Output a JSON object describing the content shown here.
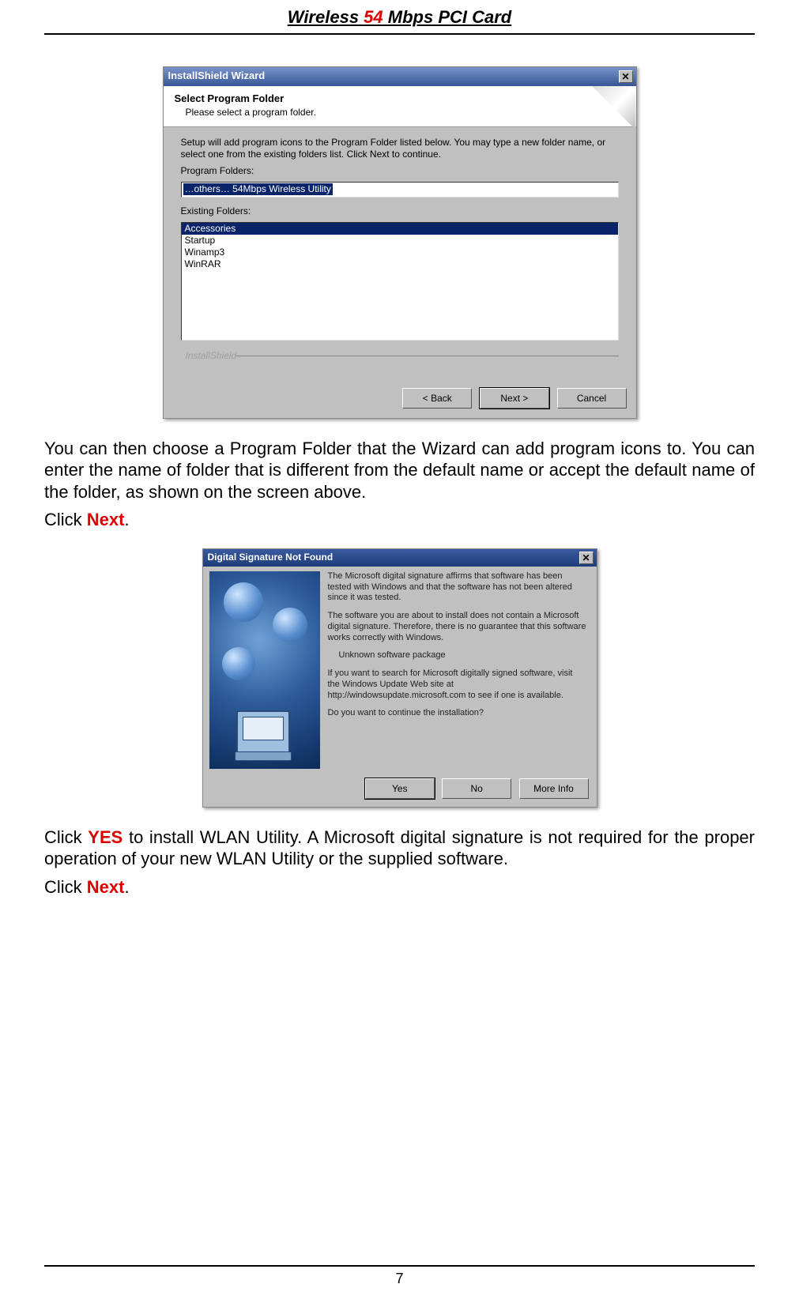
{
  "header": {
    "pre": "Wireless ",
    "mid": "54",
    "post": " Mbps PCI Card"
  },
  "dialog1": {
    "title": "InstallShield Wizard",
    "heading": "Select Program Folder",
    "subheading": "Please select a program folder.",
    "instruction": "Setup will add program icons to the Program Folder listed below.  You may type a new folder name, or select one from the existing folders list.  Click Next to continue.",
    "folders_label": "Program Folders:",
    "folders_value": "…others… 54Mbps Wireless Utility",
    "existing_label": "Existing Folders:",
    "existing_items": [
      "Accessories",
      "Startup",
      "Winamp3",
      "WinRAR"
    ],
    "brand": "InstallShield",
    "buttons": {
      "back": "< Back",
      "next": "Next >",
      "cancel": "Cancel"
    }
  },
  "para1": "You can then choose a Program Folder that the Wizard can add program icons to. You can enter the name of folder that is different from the default name or accept the default name of the folder, as shown on the screen above.",
  "click_next_pre": "Click ",
  "click_next_word": "Next",
  "click_next_post": ".",
  "dialog2": {
    "title": "Digital Signature Not Found",
    "p1": "The Microsoft digital signature affirms that software has been tested with Windows and that the software has not been altered since it was tested.",
    "p2": "The software you are about to install does not contain a Microsoft digital signature. Therefore, there is no guarantee that this software works correctly with Windows.",
    "pkg": "Unknown software package",
    "p3": "If you want to search for Microsoft digitally signed software, visit the Windows Update Web site at http://windowsupdate.microsoft.com to see if one is available.",
    "p4": "Do you want to continue the installation?",
    "buttons": {
      "yes": "Yes",
      "no": "No",
      "more": "More Info"
    }
  },
  "para2_pre": "Click ",
  "para2_yes": "YES",
  "para2_post": " to install WLAN Utility.  A Microsoft digital signature is not required for the proper operation of your new WLAN Utility or the supplied software.",
  "footer_page": "7"
}
